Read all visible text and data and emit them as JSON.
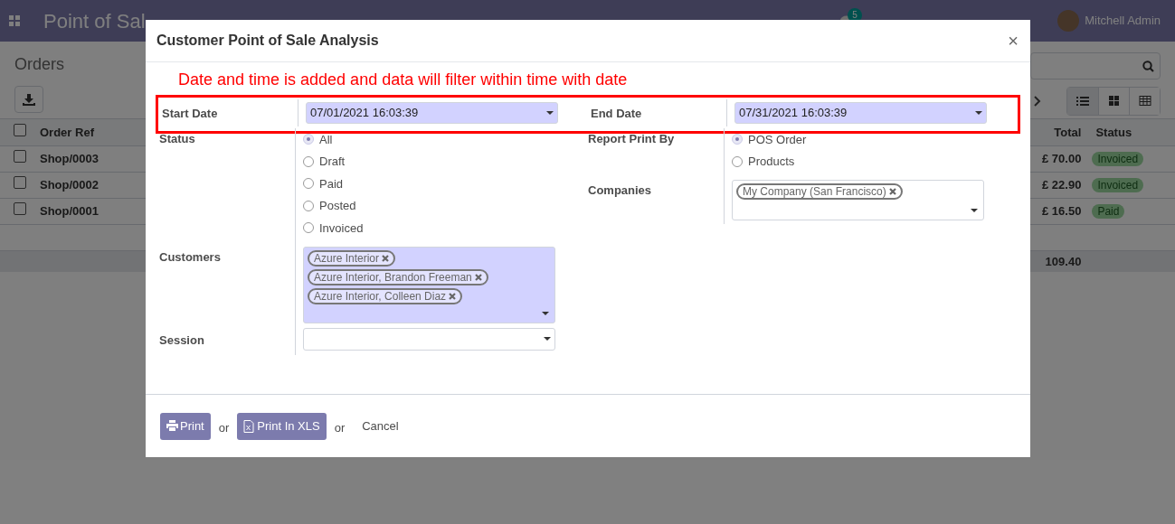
{
  "navbar": {
    "app_title": "Point of Sal",
    "chat_count": "5",
    "user": "Mitchell Admin"
  },
  "page": {
    "title": "Orders",
    "views": [
      {
        "kind": "list",
        "selected": true
      },
      {
        "kind": "kanban",
        "selected": false
      },
      {
        "kind": "pivot",
        "selected": false
      }
    ],
    "table": {
      "all_checked": false,
      "columns": [
        "Order Ref",
        "Total",
        "Status"
      ],
      "rows": [
        {
          "checked": false,
          "ref": "Shop/0003",
          "total": "£ 70.00",
          "status": "Invoiced"
        },
        {
          "checked": false,
          "ref": "Shop/0002",
          "total": "£ 22.90",
          "status": "Invoiced"
        },
        {
          "checked": false,
          "ref": "Shop/0001",
          "total": "£ 16.50",
          "status": "Paid"
        }
      ],
      "sum": "109.40"
    }
  },
  "dialog": {
    "title": "Customer Point of Sale Analysis",
    "close": "×",
    "note": "Date and time is added and data will filter within time with date",
    "start_date": {
      "label": "Start Date",
      "value": "07/01/2021 16:03:39",
      "required": true
    },
    "end_date": {
      "label": "End Date",
      "value": "07/31/2021 16:03:39",
      "required": true
    },
    "status": {
      "label": "Status",
      "options": [
        {
          "label": "All",
          "selected": true
        },
        {
          "label": "Draft",
          "selected": false
        },
        {
          "label": "Paid",
          "selected": false
        },
        {
          "label": "Posted",
          "selected": false
        },
        {
          "label": "Invoiced",
          "selected": false
        }
      ]
    },
    "report_print_by": {
      "label": "Report Print By",
      "options": [
        {
          "label": "POS Order",
          "selected": true
        },
        {
          "label": "Products",
          "selected": false
        }
      ]
    },
    "companies": {
      "label": "Companies",
      "tags": [
        "My Company (San Francisco)"
      ],
      "required": false
    },
    "customers": {
      "label": "Customers",
      "tags": [
        "Azure Interior",
        "Azure Interior, Brandon Freeman",
        "Azure Interior, Colleen Diaz"
      ],
      "required": true
    },
    "session": {
      "label": "Session",
      "required": false
    },
    "footer": [
      {
        "kind": "print",
        "label": "Print"
      },
      {
        "kind": "text",
        "label": "or"
      },
      {
        "kind": "xls",
        "label": "Print In XLS"
      },
      {
        "kind": "text",
        "label": "or"
      },
      {
        "kind": "link",
        "label": "Cancel"
      }
    ]
  }
}
